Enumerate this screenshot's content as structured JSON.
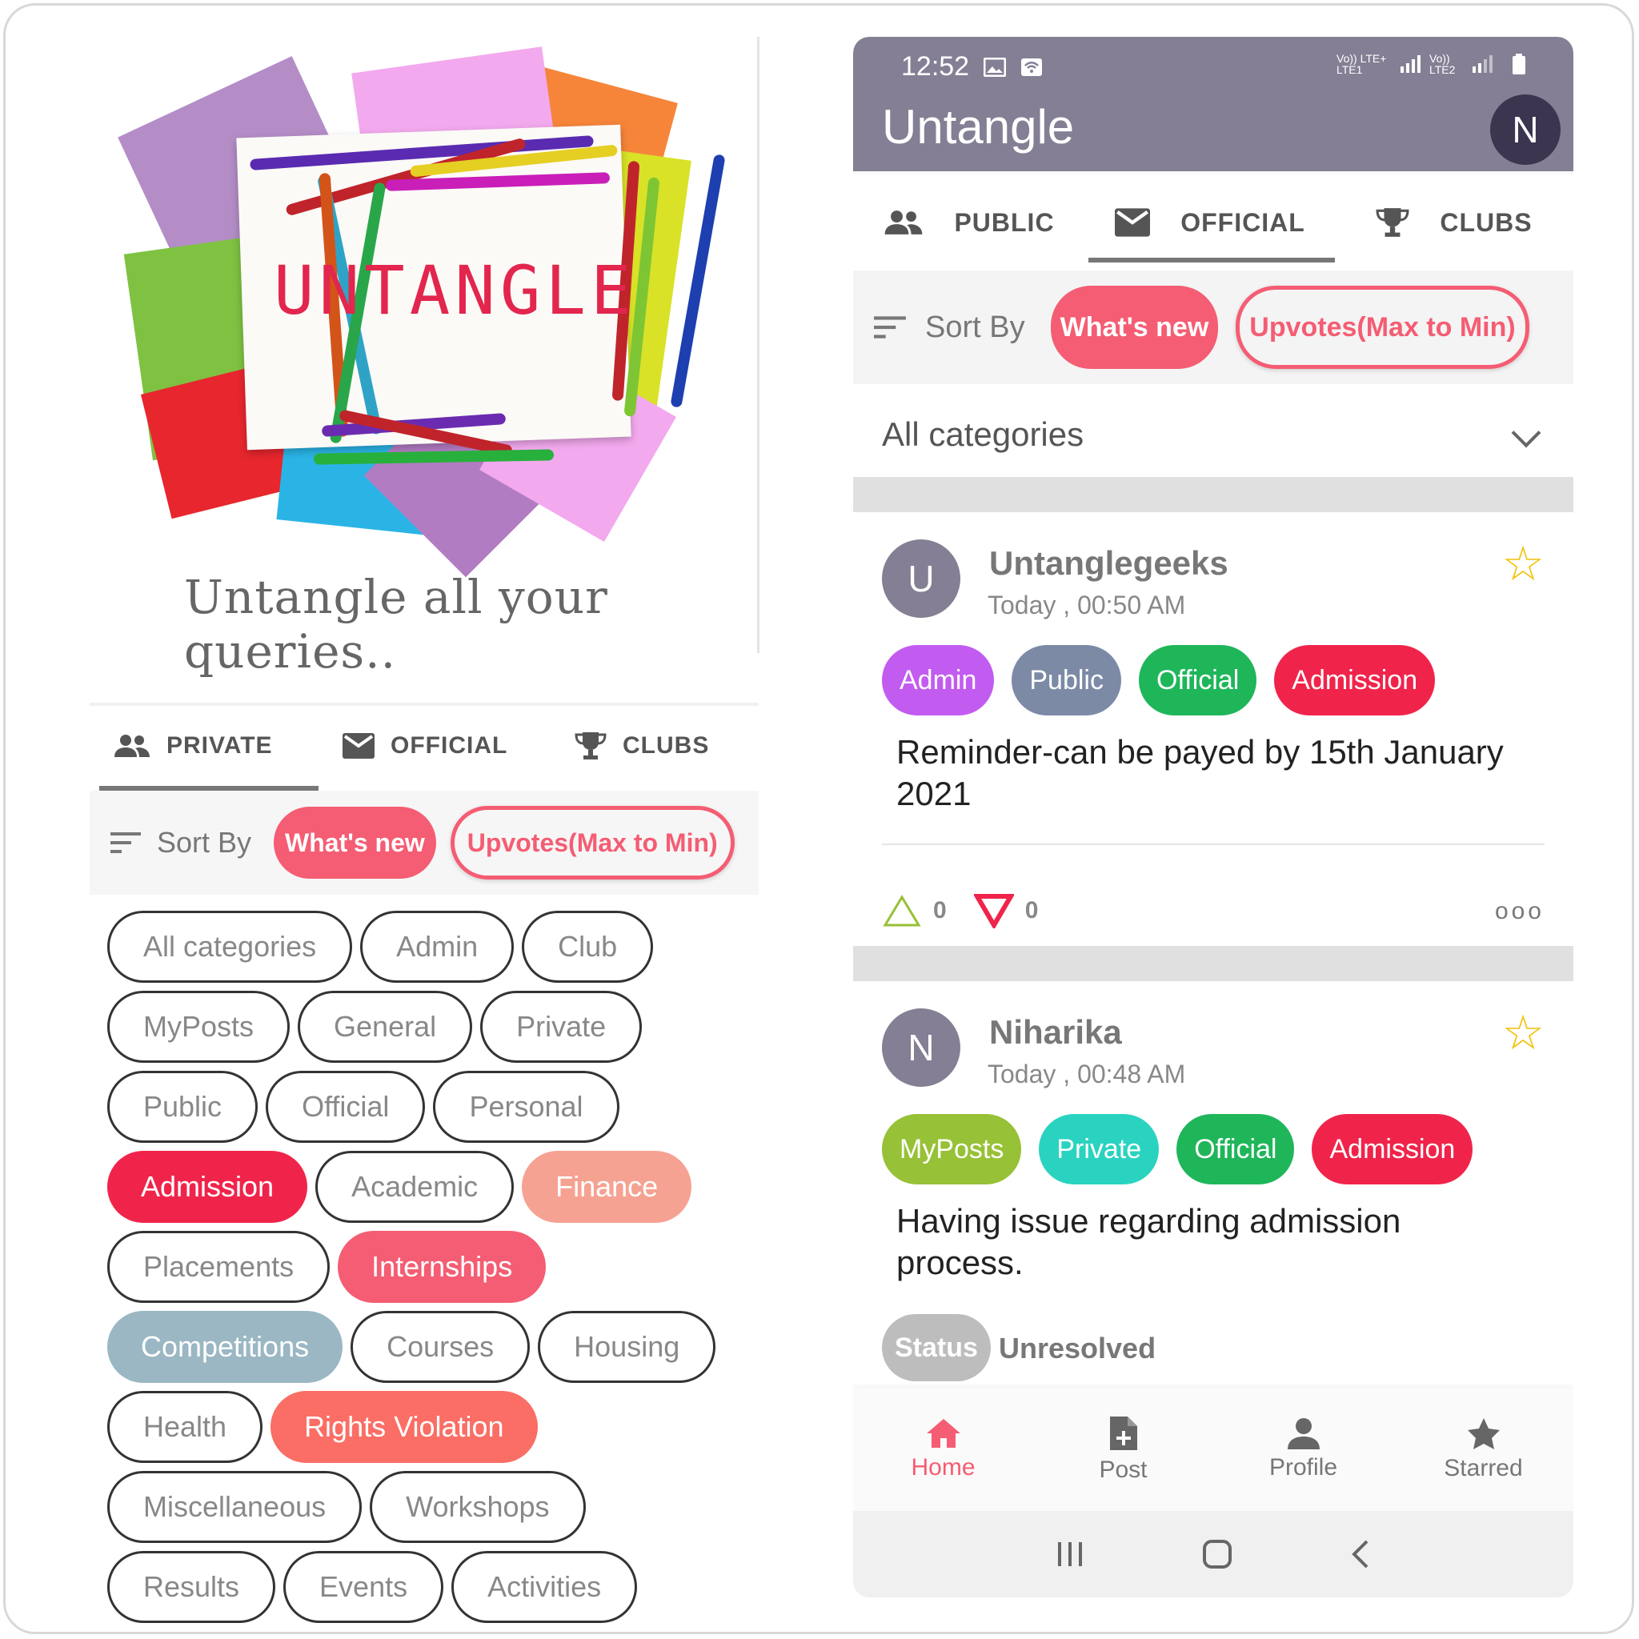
{
  "left": {
    "logo_word": "UNTANGLE",
    "tagline": "Untangle all your queries..",
    "tabs": [
      {
        "label": "PRIVATE",
        "icon": "people-icon",
        "active": true
      },
      {
        "label": "OFFICIAL",
        "icon": "mail-icon",
        "active": false
      },
      {
        "label": "CLUBS",
        "icon": "trophy-icon",
        "active": false
      }
    ],
    "sort_label": "Sort By",
    "sort_options": [
      "What's new",
      "Upvotes(Max to Min)"
    ],
    "categories": [
      [
        {
          "label": "All categories"
        },
        {
          "label": "Admin"
        },
        {
          "label": "Club"
        }
      ],
      [
        {
          "label": "MyPosts"
        },
        {
          "label": "General"
        },
        {
          "label": "Private"
        }
      ],
      [
        {
          "label": "Public"
        },
        {
          "label": "Official"
        },
        {
          "label": "Personal"
        }
      ],
      [
        {
          "label": "Admission",
          "color": "#f0244b"
        },
        {
          "label": "Academic"
        },
        {
          "label": "Finance",
          "color": "#f6a292"
        }
      ],
      [
        {
          "label": "Placements"
        },
        {
          "label": "Internships",
          "color": "#f45d73"
        }
      ],
      [
        {
          "label": "Competitions",
          "color": "#9ab7c3"
        },
        {
          "label": "Courses"
        },
        {
          "label": "Housing"
        }
      ],
      [
        {
          "label": "Health"
        },
        {
          "label": "Rights Violation",
          "color": "#fa6e65"
        }
      ],
      [
        {
          "label": "Miscellaneous"
        },
        {
          "label": "Workshops"
        }
      ],
      [
        {
          "label": "Results"
        },
        {
          "label": "Events"
        },
        {
          "label": "Activities"
        }
      ]
    ]
  },
  "right": {
    "status_time": "12:52",
    "status_signal_1": "Vo)) LTE+ LTE1",
    "status_signal_2": "Vo)) LTE2",
    "app_title": "Untangle",
    "avatar_letter": "N",
    "tabs": [
      {
        "label": "PUBLIC",
        "icon": "people-icon",
        "active": false
      },
      {
        "label": "OFFICIAL",
        "icon": "mail-icon",
        "active": true
      },
      {
        "label": "CLUBS",
        "icon": "trophy-icon",
        "active": false
      }
    ],
    "sort_label": "Sort By",
    "sort_options": [
      "What's new",
      "Upvotes(Max to Min)"
    ],
    "category_select": "All categories",
    "posts": [
      {
        "avatar": "U",
        "author": "Untanglegeeks",
        "time": "Today , 00:50 AM",
        "tags": [
          {
            "label": "Admin",
            "color": "#c25cf0"
          },
          {
            "label": "Public",
            "color": "#7c8aa6"
          },
          {
            "label": "Official",
            "color": "#1fb65a"
          },
          {
            "label": "Admission",
            "color": "#f0244b"
          }
        ],
        "text": "Reminder-can be payed by 15th January 2021",
        "upvotes": "0",
        "downvotes": "0",
        "more": "ooo"
      },
      {
        "avatar": "N",
        "author": "Niharika",
        "time": "Today , 00:48 AM",
        "tags": [
          {
            "label": "MyPosts",
            "color": "#97c136"
          },
          {
            "label": "Private",
            "color": "#2ad3c0"
          },
          {
            "label": "Official",
            "color": "#1fb65a"
          },
          {
            "label": "Admission",
            "color": "#f0244b"
          }
        ],
        "text": "Having issue regarding admission process.",
        "status_label": "Status",
        "status_value": "Unresolved"
      }
    ],
    "bottom_nav": [
      {
        "label": "Home",
        "icon": "home-icon",
        "active": true
      },
      {
        "label": "Post",
        "icon": "post-add-icon",
        "active": false
      },
      {
        "label": "Profile",
        "icon": "person-icon",
        "active": false
      },
      {
        "label": "Starred",
        "icon": "star-icon",
        "active": false
      }
    ]
  },
  "colors": {
    "accent": "#f45d73",
    "appbar": "#847f94",
    "star": "#f2c20c",
    "upvote": "#97c136",
    "downvote": "#f0244b"
  }
}
